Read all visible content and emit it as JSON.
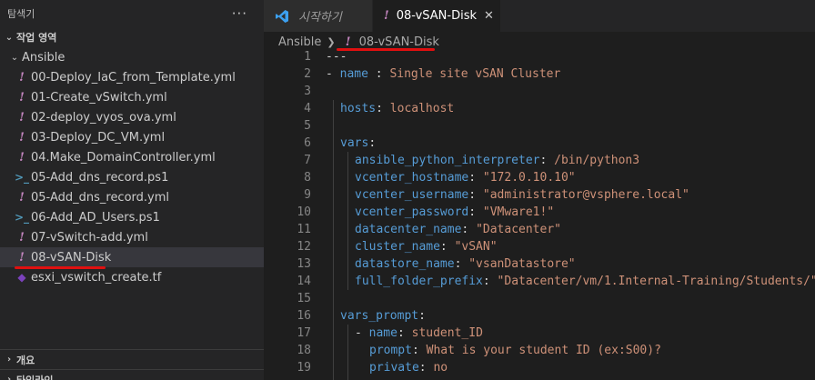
{
  "explorer": {
    "title": "탐색기",
    "more": "···",
    "workspace_label": "작업 영역",
    "folder": "Ansible",
    "files": [
      {
        "name": "00-Deploy_IaC_from_Template.yml",
        "icon": "yaml-icon"
      },
      {
        "name": "01-Create_vSwitch.yml",
        "icon": "yaml-icon"
      },
      {
        "name": "02-deploy_vyos_ova.yml",
        "icon": "yaml-icon"
      },
      {
        "name": "03-Deploy_DC_VM.yml",
        "icon": "yaml-icon"
      },
      {
        "name": "04.Make_DomainController.yml",
        "icon": "yaml-icon"
      },
      {
        "name": "05-Add_dns_record.ps1",
        "icon": "powershell-icon"
      },
      {
        "name": "05-Add_dns_record.yml",
        "icon": "yaml-icon"
      },
      {
        "name": "06-Add_AD_Users.ps1",
        "icon": "powershell-icon"
      },
      {
        "name": "07-vSwitch-add.yml",
        "icon": "yaml-icon"
      },
      {
        "name": "08-vSAN-Disk",
        "icon": "yaml-icon"
      },
      {
        "name": "esxi_vswitch_create.tf",
        "icon": "terraform-icon"
      }
    ],
    "outline_label": "개요",
    "timeline_label": "타임라인"
  },
  "tabs": [
    {
      "label": "시작하기",
      "icon": "vscode-icon"
    },
    {
      "label": "08-vSAN-Disk",
      "icon": "yaml-icon"
    }
  ],
  "breadcrumb": {
    "folder": "Ansible",
    "file": "08-vSAN-Disk"
  },
  "code": [
    {
      "n": "1"
    },
    {
      "n": "2"
    },
    {
      "n": "3"
    },
    {
      "n": "4"
    },
    {
      "n": "5"
    },
    {
      "n": "6"
    },
    {
      "n": "7"
    },
    {
      "n": "8"
    },
    {
      "n": "9"
    },
    {
      "n": "10"
    },
    {
      "n": "11"
    },
    {
      "n": "12"
    },
    {
      "n": "13"
    },
    {
      "n": "14"
    },
    {
      "n": "15"
    },
    {
      "n": "16"
    },
    {
      "n": "17"
    },
    {
      "n": "18"
    },
    {
      "n": "19"
    }
  ],
  "yaml": {
    "doc_start": "---",
    "dash": "- ",
    "name_key": "name",
    "name_val": "Single site vSAN Cluster",
    "hosts_key": "hosts",
    "hosts_val": "localhost",
    "vars_key": "vars",
    "interp_key": "ansible_python_interpreter",
    "interp_val": "/bin/python3",
    "vc_host_key": "vcenter_hostname",
    "vc_host_val": "\"172.0.10.10\"",
    "vc_user_key": "vcenter_username",
    "vc_user_val": "\"administrator@vsphere.local\"",
    "vc_pass_key": "vcenter_password",
    "vc_pass_val": "\"VMware1!\"",
    "dc_key": "datacenter_name",
    "dc_val": "\"Datacenter\"",
    "cl_key": "cluster_name",
    "cl_val": "\"vSAN\"",
    "ds_key": "datastore_name",
    "ds_val": "\"vsanDatastore\"",
    "ff_key": "full_folder_prefix",
    "ff_val": "\"Datacenter/vm/1.Internal-Training/Students/\"",
    "vp_key": "vars_prompt",
    "vp_name_key": "name",
    "vp_name_val": "student_ID",
    "prompt_key": "prompt",
    "prompt_val": "What is your student ID (ex:S00)?",
    "private_key": "private",
    "private_val": "no"
  },
  "colors": {
    "annotation_red": "#e01010",
    "yaml_key": "#569cd6",
    "yaml_string": "#ce9178"
  }
}
